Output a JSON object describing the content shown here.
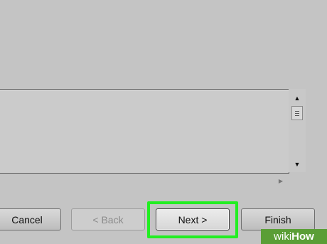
{
  "buttons": {
    "cancel": "Cancel",
    "back": "< Back",
    "next": "Next >",
    "finish": "Finish"
  },
  "scrollbar": {
    "up_icon": "triangle-up-icon",
    "down_icon": "triangle-down-icon",
    "right_icon": "triangle-right-icon"
  },
  "watermark": {
    "prefix": "wiki",
    "suffix": "How"
  },
  "colors": {
    "highlight": "#22ee22",
    "watermark_bg": "#5a9e36"
  }
}
